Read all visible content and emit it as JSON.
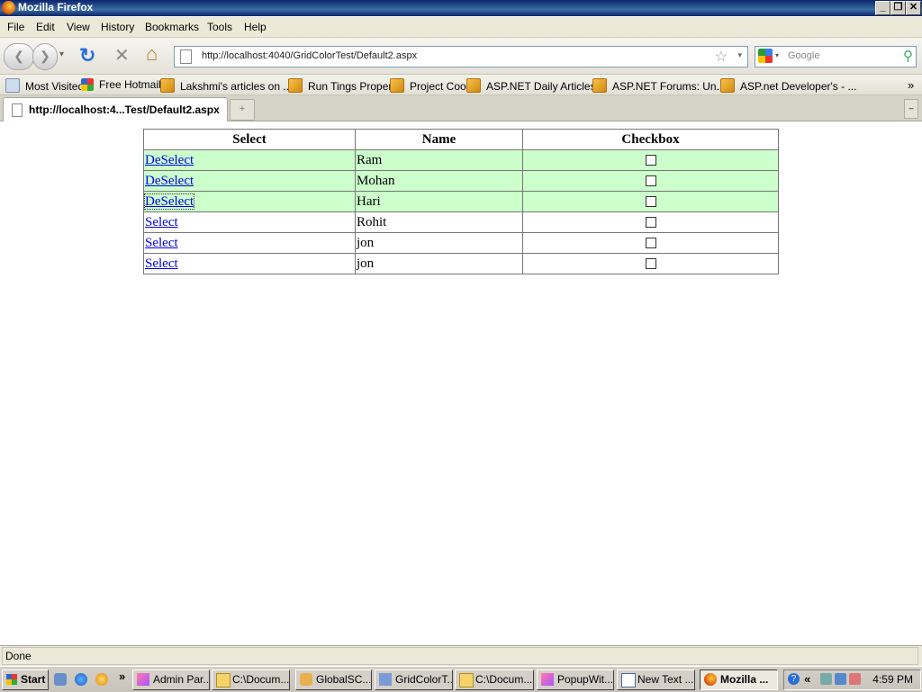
{
  "window": {
    "title": "Mozilla Firefox",
    "min": "_",
    "max": "❐",
    "close": "✕"
  },
  "menu": [
    "File",
    "Edit",
    "View",
    "History",
    "Bookmarks",
    "Tools",
    "Help"
  ],
  "toolbar": {
    "back": "❮",
    "forward": "❯",
    "history_dd": "▾",
    "reload": "↻",
    "stop": "✕",
    "home": "⌂",
    "url": "http://localhost:4040/GridColorTest/Default2.aspx",
    "star": "☆",
    "url_dd": "▾",
    "search_placeholder": "Google",
    "search_engine_dd": "▾",
    "search_go": "⚲"
  },
  "bookmarks": [
    "Most Visited",
    "Free Hotmail",
    "Lakshmi's articles on ...",
    "Run Tings Proper",
    "Project Cool",
    "ASP.NET Daily Articles",
    "ASP.NET Forums: Un...",
    "ASP.net Developer's - ..."
  ],
  "bookmarks_more": "»",
  "tabs": {
    "active_title": "http://localhost:4...Test/Default2.aspx",
    "new_tab": "+",
    "list": "–"
  },
  "grid": {
    "headers": [
      "Select",
      "Name",
      "Checkbox"
    ],
    "rows": [
      {
        "link": "DeSelect",
        "name": "Ram",
        "selected": true
      },
      {
        "link": "DeSelect",
        "name": "Mohan",
        "selected": true
      },
      {
        "link": "DeSelect",
        "name": "Hari",
        "selected": true
      },
      {
        "link": "Select",
        "name": "Rohit",
        "selected": false
      },
      {
        "link": "Select",
        "name": "jon",
        "selected": false
      },
      {
        "link": "Select",
        "name": "jon",
        "selected": false
      }
    ],
    "selected_color": "#ccffcc"
  },
  "status": {
    "text": "Done"
  },
  "taskbar": {
    "start": "Start",
    "quicklaunch_more": "»",
    "tasks": [
      "Admin Par...",
      "C:\\Docum...",
      "GlobalSC...",
      "GridColorT...",
      "C:\\Docum...",
      "PopupWit...",
      "New Text ...",
      "Mozilla ..."
    ],
    "tray_left": "«",
    "clock": "4:59 PM"
  }
}
